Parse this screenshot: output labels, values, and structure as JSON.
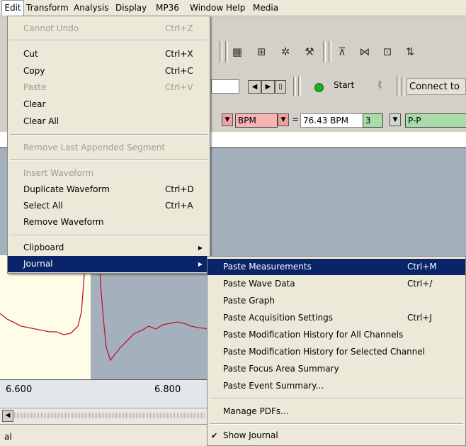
{
  "menubar": [
    "Edit",
    "Transform",
    "Analysis",
    "Display",
    "MP36",
    "Window",
    "Help",
    "Media"
  ],
  "edit_menu": {
    "cannot_undo": {
      "label": "Cannot Undo",
      "shortcut": "Ctrl+Z"
    },
    "cut": {
      "label": "Cut",
      "shortcut": "Ctrl+X"
    },
    "copy": {
      "label": "Copy",
      "shortcut": "Ctrl+C"
    },
    "paste": {
      "label": "Paste",
      "shortcut": "Ctrl+V"
    },
    "clear": {
      "label": "Clear"
    },
    "clear_all": {
      "label": "Clear All"
    },
    "remove_last": {
      "label": "Remove Last Appended Segment"
    },
    "insert_waveform": {
      "label": "Insert Waveform"
    },
    "duplicate_waveform": {
      "label": "Duplicate Waveform",
      "shortcut": "Ctrl+D"
    },
    "select_all": {
      "label": "Select All",
      "shortcut": "Ctrl+A"
    },
    "remove_waveform": {
      "label": "Remove Waveform"
    },
    "clipboard": {
      "label": "Clipboard"
    },
    "journal": {
      "label": "Journal"
    }
  },
  "journal_menu": {
    "paste_measurements": {
      "label": "Paste Measurements",
      "shortcut": "Ctrl+M"
    },
    "paste_wave_data": {
      "label": "Paste Wave Data",
      "shortcut": "Ctrl+/"
    },
    "paste_graph": {
      "label": "Paste Graph"
    },
    "paste_acq": {
      "label": "Paste Acquisition Settings",
      "shortcut": "Ctrl+J"
    },
    "paste_mod_all": {
      "label": "Paste Modification History for All Channels"
    },
    "paste_mod_sel": {
      "label": "Paste Modification History for Selected Channel"
    },
    "paste_focus": {
      "label": "Paste Focus Area Summary"
    },
    "paste_event": {
      "label": "Paste Event Summary..."
    },
    "manage_pdfs": {
      "label": "Manage PDFs..."
    },
    "show_journal": {
      "label": "Show Journal",
      "check": "✔"
    }
  },
  "toolbar": {
    "start_label": "Start",
    "connect_label": "Connect to",
    "measurement": {
      "unit": "BPM",
      "equals": "=",
      "value": "76.43 BPM",
      "channel": "3",
      "type": "P-P"
    },
    "nav_prev": "◀",
    "nav_next": "▶"
  },
  "xaxis": {
    "tick1": "6.600",
    "tick2": "6.800"
  },
  "status": {
    "text": "al"
  },
  "colors": {
    "highlight": "#0a246a",
    "waveform": "#c8102e",
    "plot_gray": "#a4b0bb",
    "plot_yellow": "#fdfde8"
  }
}
